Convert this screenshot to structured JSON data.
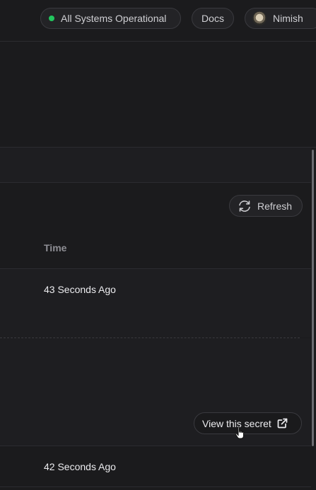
{
  "header": {
    "status_label": "All Systems Operational",
    "docs_label": "Docs",
    "user_name": "Nimish",
    "status_color": "#22c55e"
  },
  "toolbar": {
    "refresh_label": "Refresh"
  },
  "table": {
    "column_time": "Time",
    "rows": [
      {
        "time": "43 Seconds Ago"
      },
      {
        "time": "42 Seconds Ago"
      }
    ]
  },
  "expanded_row": {
    "view_secret_label": "View this secret"
  },
  "icons": {
    "refresh": "refresh-icon",
    "external_link": "external-link-icon",
    "avatar": "avatar"
  }
}
